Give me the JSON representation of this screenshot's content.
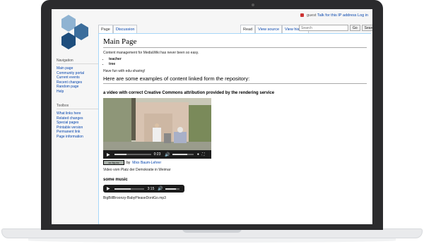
{
  "personal_tools": {
    "guest_label": "guest",
    "talk_label": "Talk for this IP address",
    "login_label": "Log in"
  },
  "navigation": {
    "heading": "Navigation",
    "items": [
      "Main page",
      "Community portal",
      "Current events",
      "Recent changes",
      "Random page",
      "Help"
    ]
  },
  "toolbox": {
    "heading": "Toolbox",
    "items": [
      "What links here",
      "Related changes",
      "Special pages",
      "Printable version",
      "Permanent link",
      "Page information"
    ]
  },
  "tabs": {
    "left": [
      "Page",
      "Discussion"
    ],
    "right": [
      "Read",
      "View source",
      "View history"
    ]
  },
  "search": {
    "placeholder": "Search",
    "go_label": "Go",
    "search_label": "Search"
  },
  "page": {
    "title": "Main Page",
    "intro": "Content management for MediaWiki has never been so easy.",
    "list": [
      "teacher",
      "tree"
    ],
    "fun": "Have fun with edu-sharing!",
    "examples_heading": "Here are some examples of content linked form the repository:",
    "video_heading": "a video with correct Creative Commons attribution provided by the rendering service",
    "video_time": "0:23",
    "video_progress": 0.33,
    "video_volume": 0.7,
    "cc_badge": "cc by-nc",
    "attribution_prefix": "by",
    "attribution_author": "Mixx Baum-Lehrer",
    "video_caption": "Video vom Platz der Demokratie in Weimar",
    "music_heading": "some music",
    "audio_time": "3:15",
    "audio_progress": 0.55,
    "audio_volume": 0.75,
    "audio_filename": "BigBillBroonzy-BabyPleaseDontGo.mp3"
  },
  "colors": {
    "link": "#0645ad",
    "logo_light": "#8fb3d2",
    "logo_mid": "#3c6e9c",
    "logo_dark": "#1e4e7d"
  }
}
